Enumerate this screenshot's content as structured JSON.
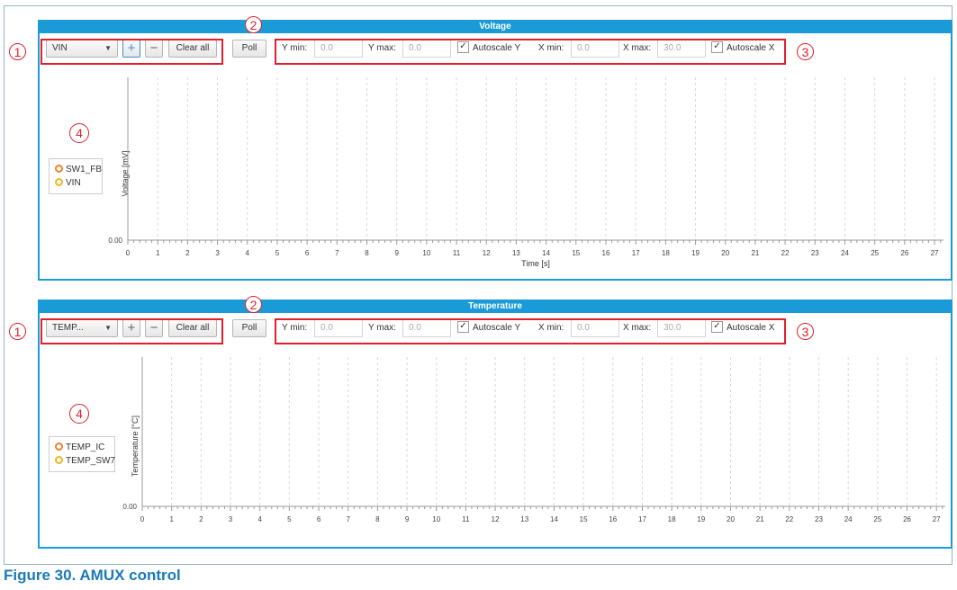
{
  "panels": [
    {
      "id": "voltage",
      "title": "Voltage",
      "signal_select": "VIN",
      "clear_all": "Clear all",
      "poll": "Poll",
      "y_min_label": "Y min:",
      "y_min_value": "0.0",
      "y_max_label": "Y max:",
      "y_max_value": "0.0",
      "autoscale_y": "Autoscale Y",
      "autoscale_y_checked": true,
      "x_min_label": "X min:",
      "x_min_value": "0.0",
      "x_max_label": "X max:",
      "x_max_value": "30.0",
      "autoscale_x": "Autoscale X",
      "autoscale_x_checked": true,
      "legend": [
        "SW1_FB",
        "VIN"
      ],
      "y_axis_label": "Voltage [mV]",
      "x_axis_label": "Time [s]",
      "y_tick": "0.00"
    },
    {
      "id": "temperature",
      "title": "Temperature",
      "signal_select": "TEMP...",
      "clear_all": "Clear all",
      "poll": "Poll",
      "y_min_label": "Y min:",
      "y_min_value": "0.0",
      "y_max_label": "Y max:",
      "y_max_value": "0.0",
      "autoscale_y": "Autoscale Y",
      "autoscale_y_checked": true,
      "x_min_label": "X min:",
      "x_min_value": "0.0",
      "x_max_label": "X max:",
      "x_max_value": "30.0",
      "autoscale_x": "Autoscale X",
      "autoscale_x_checked": true,
      "legend": [
        "TEMP_IC",
        "TEMP_SW7"
      ],
      "y_axis_label": "Temperature [°C]",
      "x_axis_label": "",
      "y_tick": "0.00"
    }
  ],
  "x_ticks": [
    "0",
    "1",
    "2",
    "3",
    "4",
    "5",
    "6",
    "7",
    "8",
    "9",
    "10",
    "11",
    "12",
    "13",
    "14",
    "15",
    "16",
    "17",
    "18",
    "19",
    "20",
    "21",
    "22",
    "23",
    "24",
    "25",
    "26",
    "27"
  ],
  "callouts": {
    "one": "1",
    "two": "2",
    "three": "3",
    "four": "4"
  },
  "caption": "Figure 30.  AMUX control",
  "colors": {
    "header": "#1a9bd7",
    "callout": "#e0202c",
    "series1": "#f58025",
    "series2": "#f5b31f",
    "caption": "#1a7ab8"
  }
}
